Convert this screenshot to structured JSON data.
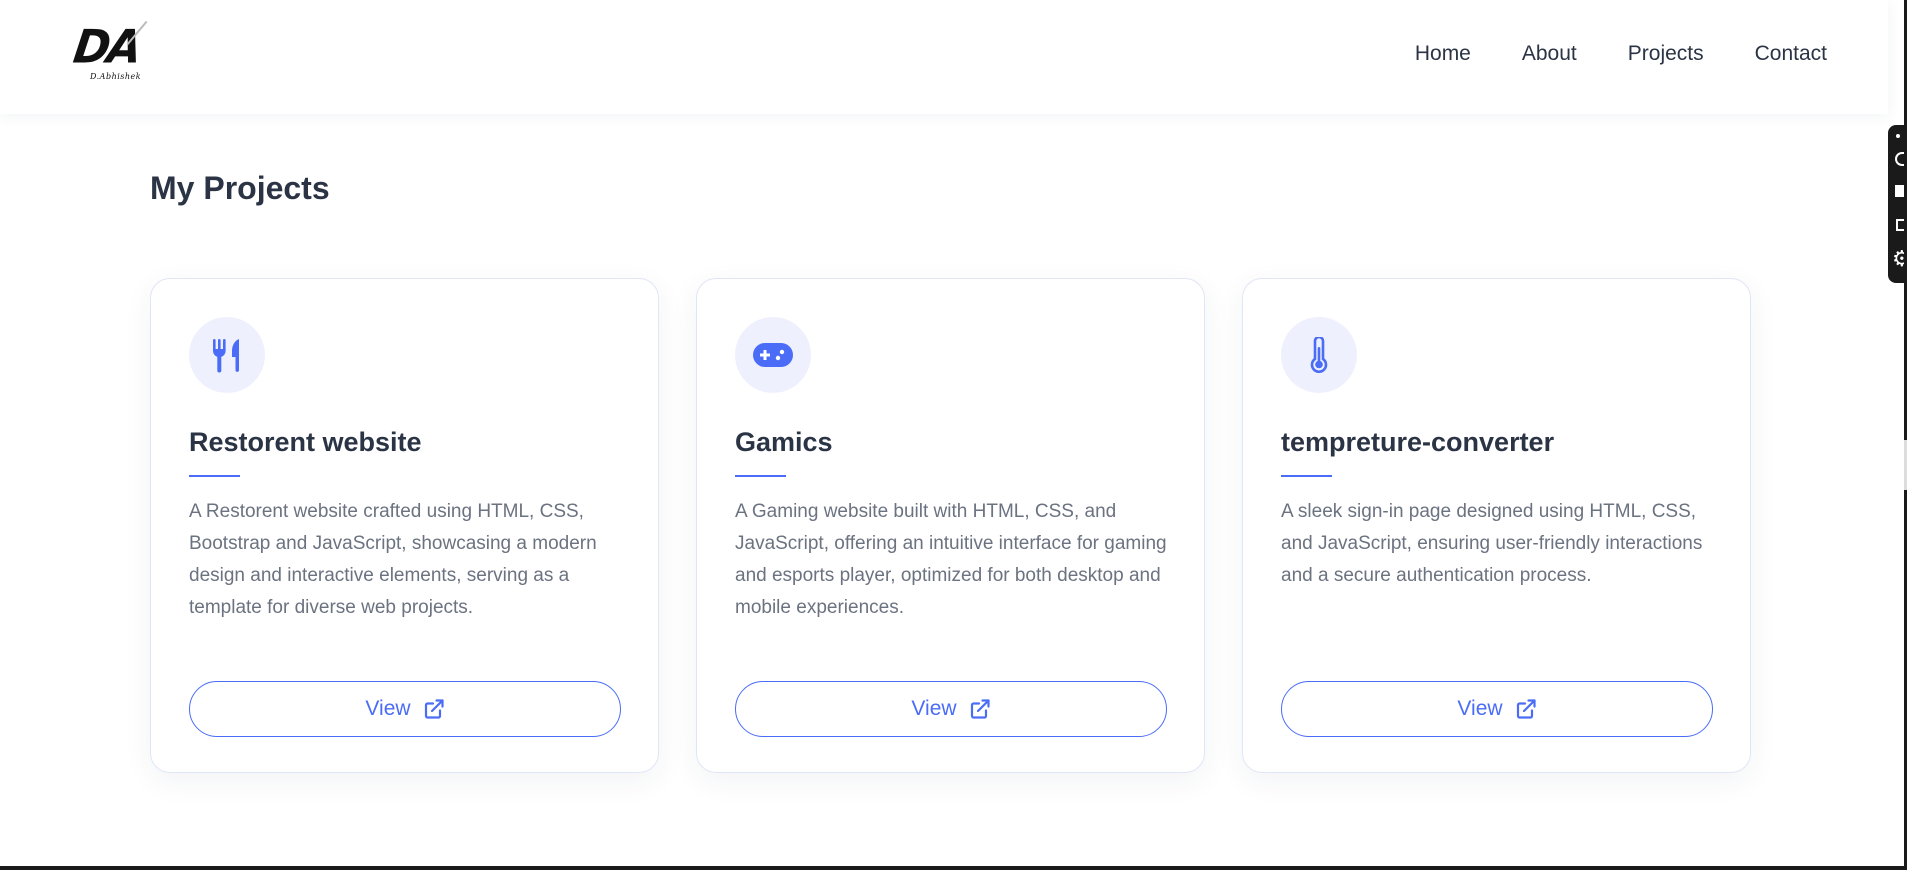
{
  "logo": {
    "letters": "DA",
    "subtitle": "D.Abhishek"
  },
  "nav": {
    "items": [
      "Home",
      "About",
      "Projects",
      "Contact"
    ]
  },
  "section": {
    "title": "My Projects"
  },
  "projects": [
    {
      "icon": "utensils-icon",
      "title": "Restorent website",
      "description": "A Restorent website crafted using HTML, CSS, Bootstrap and JavaScript, showcasing a modern design and interactive elements, serving as a template for diverse web projects.",
      "button_label": "View"
    },
    {
      "icon": "gamepad-icon",
      "title": "Gamics",
      "description": "A Gaming website built with HTML, CSS, and JavaScript, offering an intuitive interface for gaming and esports player, optimized for both desktop and mobile experiences.",
      "button_label": "View"
    },
    {
      "icon": "thermometer-icon",
      "title": "tempreture-converter",
      "description": "A sleek sign-in page designed using HTML, CSS, and JavaScript, ensuring user-friendly interactions and a secure authentication process.",
      "button_label": "View"
    }
  ],
  "colors": {
    "accent": "#4a6cf7",
    "icon_bg": "#eef1fd",
    "heading": "#2b3445",
    "body_text": "#6b7280"
  }
}
